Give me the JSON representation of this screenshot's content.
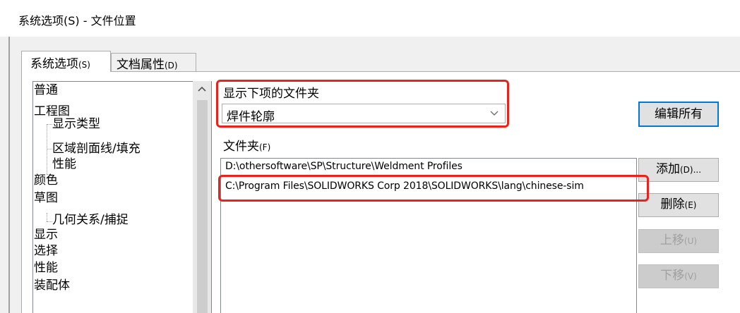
{
  "window": {
    "title": "系统选项(S) - 文件位置"
  },
  "tabs": [
    {
      "label": "系统选项",
      "hotkey": "(S)"
    },
    {
      "label": "文档属性",
      "hotkey": "(D)"
    }
  ],
  "tree": {
    "items": [
      "普通",
      "工程图",
      "显示类型",
      "区域剖面线/填充",
      "性能",
      "颜色",
      "草图",
      "几何关系/捕捉",
      "显示",
      "选择",
      "性能",
      "装配体"
    ]
  },
  "folders_panel": {
    "show_folders_label": "显示下项的文件夹",
    "folder_type_value": "焊件轮廓",
    "folders_label": "文件夹",
    "folders_hotkey": "(F)",
    "paths": [
      "D:\\othersoftware\\SP\\Structure\\Weldment Profiles",
      "C:\\Program Files\\SOLIDWORKS Corp 2018\\SOLIDWORKS\\lang\\chinese-sim"
    ]
  },
  "buttons": {
    "edit_all": "编辑所有",
    "add": "添加",
    "add_hotkey": "(D)...",
    "delete": "删除",
    "delete_hotkey": "(E)",
    "move_up": "上移",
    "move_up_hotkey": "(U)",
    "move_down": "下移",
    "move_down_hotkey": "(V)"
  },
  "icons": {
    "scroll_up": "chevron-up-icon",
    "combo_dropdown": "chevron-down-icon"
  },
  "colors": {
    "highlight_box": "#e8231d",
    "default_button_border": "#0078d7"
  }
}
